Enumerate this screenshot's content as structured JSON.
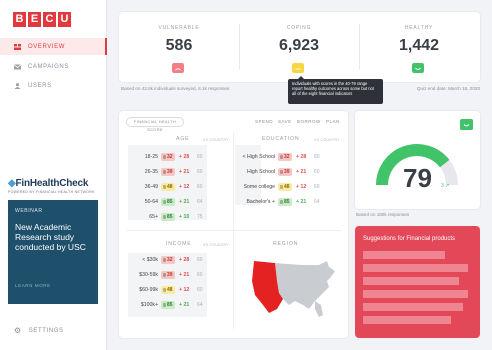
{
  "brand": {
    "letters": [
      "B",
      "E",
      "C",
      "U"
    ],
    "color": "#e03a3e"
  },
  "sidebar": {
    "items": [
      {
        "label": "OVERVIEW",
        "icon": "overview-icon",
        "active": true
      },
      {
        "label": "CAMPAIGNS",
        "icon": "mail-icon",
        "active": false
      },
      {
        "label": "USERS",
        "icon": "user-icon",
        "active": false
      }
    ],
    "partner": {
      "name": "FinHealthCheck",
      "tagline": "POWERED BY FINANCIAL HEALTH NETWORK"
    },
    "webinar": {
      "tag": "WEBINAR",
      "text": "New Academic Research study conducted by USC",
      "link": "LEARN MORE"
    },
    "settings": "SETTINGS"
  },
  "stats": [
    {
      "label": "VULNERABLE",
      "value": "586",
      "color": "#f47e86"
    },
    {
      "label": "COPING",
      "value": "6,923",
      "color": "#f7d640"
    },
    {
      "label": "HEALTHY",
      "value": "1,442",
      "color": "#41c36a"
    }
  ],
  "summary": {
    "left": "Based on 43.8k individuals surveyed, 8.1k responses",
    "right": "Quiz end date: March 15, 2020"
  },
  "tooltip": "Individuals with scores in the 40-79 range report healthy outcomes across some but not all of the eight financial indicators",
  "panel": {
    "chip": "FINANCIAL HEALTH SCORE",
    "menu": [
      "SPEND",
      "SAVE",
      "BORROW",
      "PLAN"
    ],
    "sections": {
      "age": {
        "title": "AGE",
        "sub": "VS COUNTRY",
        "rows": [
          {
            "label": "18-25",
            "score": "32",
            "level": "r",
            "delta": "+ 28",
            "dir": "up",
            "nat": "60"
          },
          {
            "label": "26-35",
            "score": "39",
            "level": "r",
            "delta": "+ 21",
            "dir": "up",
            "nat": "60"
          },
          {
            "label": "36-49",
            "score": "48",
            "level": "y",
            "delta": "+ 12",
            "dir": "up",
            "nat": "60"
          },
          {
            "label": "50-64",
            "score": "85",
            "level": "g",
            "delta": "+ 21",
            "dir": "down",
            "nat": "64"
          },
          {
            "label": "65+",
            "score": "85",
            "level": "g",
            "delta": "+ 10",
            "dir": "down",
            "nat": "75"
          }
        ]
      },
      "education": {
        "title": "EDUCATION",
        "sub": "VS COUNTRY",
        "rows": [
          {
            "label": "< High School",
            "score": "32",
            "level": "r",
            "delta": "+ 28",
            "dir": "up",
            "nat": "60"
          },
          {
            "label": "High School",
            "score": "39",
            "level": "r",
            "delta": "+ 21",
            "dir": "up",
            "nat": "60"
          },
          {
            "label": "Some college",
            "score": "48",
            "level": "y",
            "delta": "+ 12",
            "dir": "up",
            "nat": "60"
          },
          {
            "label": "Bachelor's +",
            "score": "85",
            "level": "g",
            "delta": "+ 21",
            "dir": "down",
            "nat": "64"
          }
        ]
      },
      "income": {
        "title": "INCOME",
        "sub": "VS COUNTRY",
        "rows": [
          {
            "label": "< $30k",
            "score": "32",
            "level": "r",
            "delta": "+ 28",
            "dir": "up",
            "nat": "60"
          },
          {
            "label": "$30-59k",
            "score": "39",
            "level": "r",
            "delta": "+ 21",
            "dir": "up",
            "nat": "60"
          },
          {
            "label": "$60-99k",
            "score": "48",
            "level": "y",
            "delta": "+ 12",
            "dir": "up",
            "nat": "60"
          },
          {
            "label": "$100k+",
            "score": "85",
            "level": "g",
            "delta": "+ 21",
            "dir": "down",
            "nat": "64"
          }
        ]
      },
      "region": {
        "title": "REGION",
        "highlight": "west",
        "highlight_color": "#e52222"
      }
    }
  },
  "gauge": {
    "score": "79",
    "change": "3",
    "fill": 0.79,
    "color": "#41c36a",
    "based_on": "Based on 180k responses"
  },
  "suggestions": {
    "title": "Suggestions for Financial products",
    "placeholder_bars": 6
  }
}
